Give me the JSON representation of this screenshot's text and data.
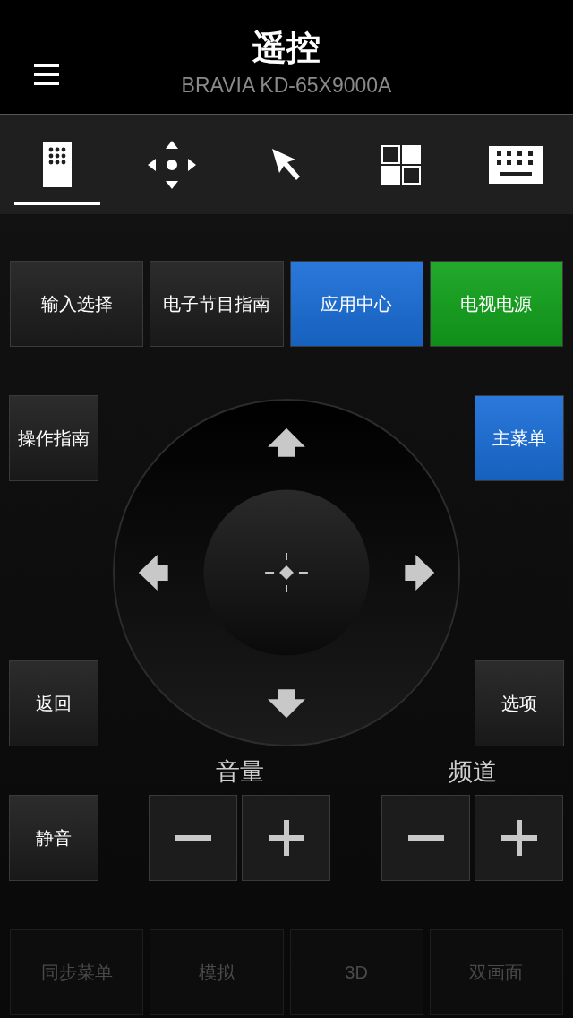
{
  "header": {
    "title": "遥控",
    "subtitle": "BRAVIA KD-65X9000A"
  },
  "tabs": [
    {
      "kind": "remote",
      "selected": true
    },
    {
      "kind": "dpad",
      "selected": false
    },
    {
      "kind": "pointer",
      "selected": false
    },
    {
      "kind": "apps",
      "selected": false
    },
    {
      "kind": "keyboard",
      "selected": false
    }
  ],
  "top_buttons": [
    {
      "label": "输入选择",
      "color": "#1c1c1c"
    },
    {
      "label": "电子节目指南",
      "color": "#1c1c1c"
    },
    {
      "label": "应用中心",
      "color": "#1a6ed8"
    },
    {
      "label": "电视电源",
      "color": "#12a21c"
    }
  ],
  "left_buttons": [
    {
      "label": "操作指南",
      "color": "#1c1c1c"
    },
    {
      "label": "返回",
      "color": "#1c1c1c"
    }
  ],
  "right_buttons": [
    {
      "label": "主菜单",
      "color": "#1a6ed8"
    },
    {
      "label": "选项",
      "color": "#1c1c1c"
    }
  ],
  "mute_button": {
    "label": "静音",
    "color": "#1c1c1c"
  },
  "volume": {
    "label": "音量"
  },
  "channel": {
    "label": "频道"
  },
  "bottom_buttons": [
    {
      "label": "同步菜单",
      "disabled": true
    },
    {
      "label": "模拟",
      "disabled": true
    },
    {
      "label": "3D",
      "disabled": true
    },
    {
      "label": "双画面",
      "disabled": true
    }
  ]
}
